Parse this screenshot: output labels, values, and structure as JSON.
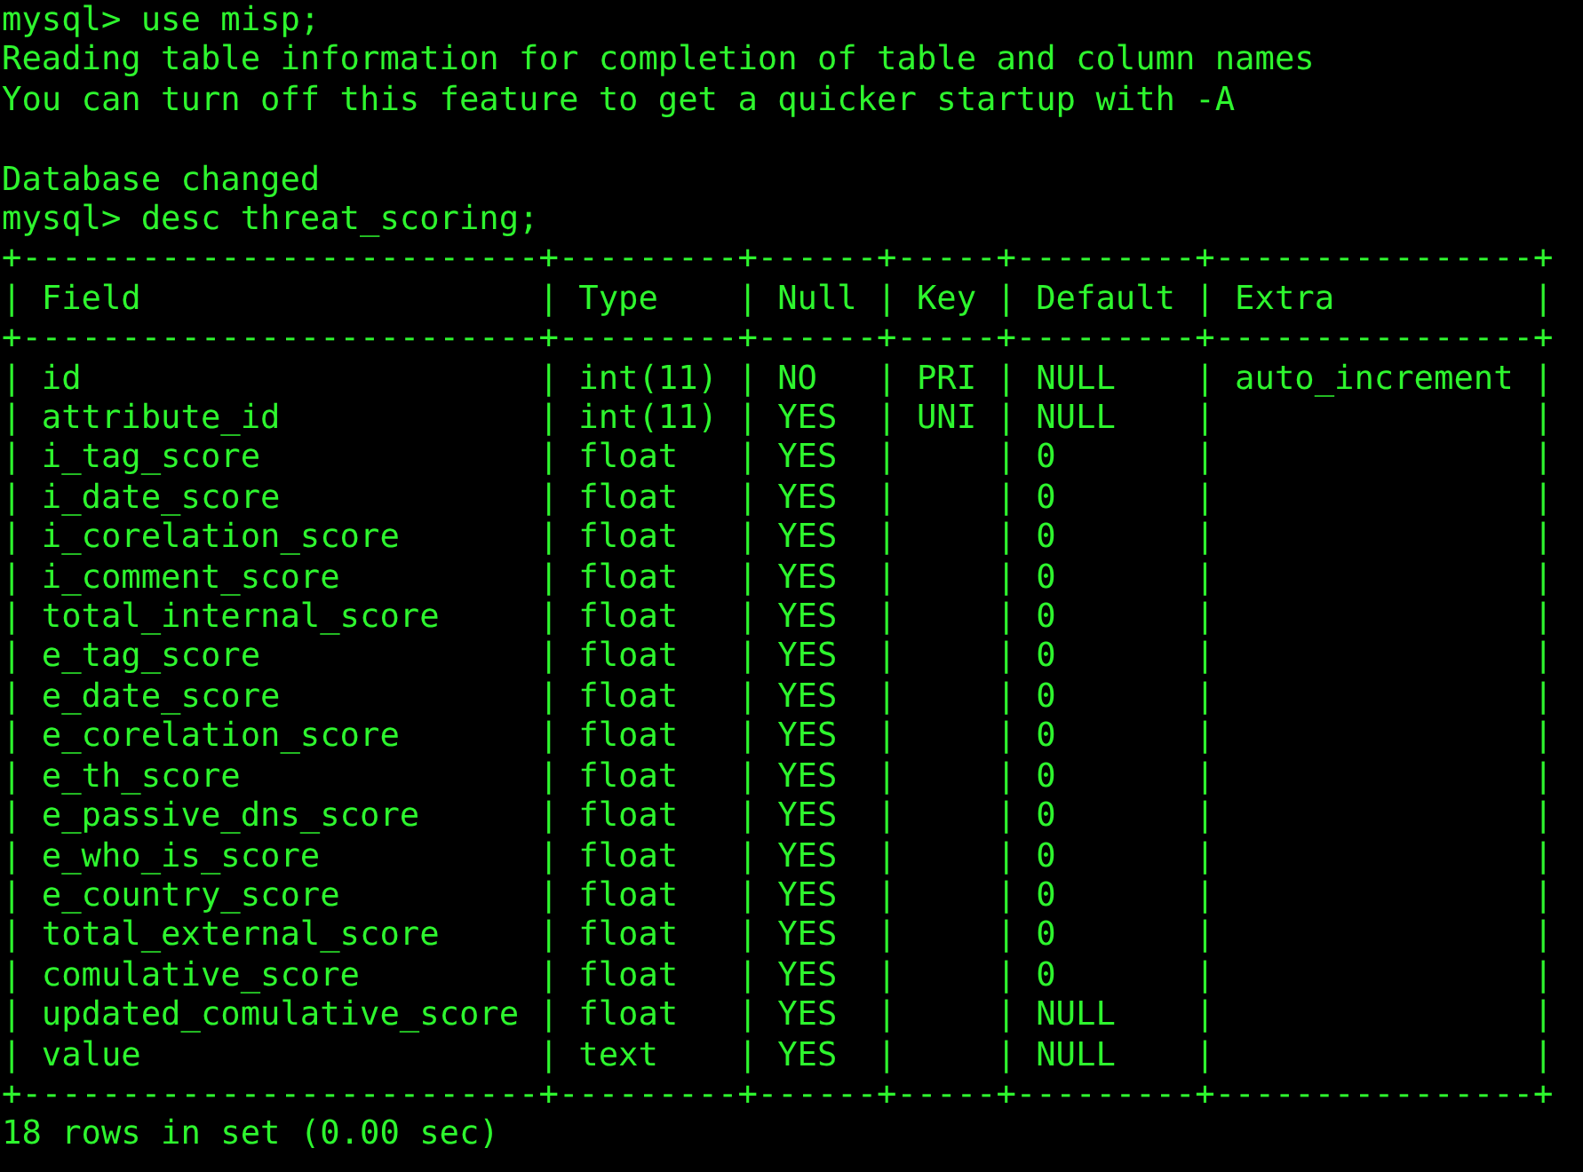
{
  "terminal": {
    "groups": [
      [
        "mysql> use misp;",
        "Reading table information for completion of table and column names",
        "You can turn off this feature to get a quicker startup with -A"
      ],
      [
        "Database changed",
        "mysql> desc threat_scoring;",
        "+--------------------------+---------+------+-----+---------+----------------+",
        "| Field                    | Type    | Null | Key | Default | Extra          |",
        "+--------------------------+---------+------+-----+---------+----------------+",
        "| id                       | int(11) | NO   | PRI | NULL    | auto_increment |",
        "| attribute_id             | int(11) | YES  | UNI | NULL    |                |",
        "| i_tag_score              | float   | YES  |     | 0       |                |",
        "| i_date_score             | float   | YES  |     | 0       |                |",
        "| i_corelation_score       | float   | YES  |     | 0       |                |",
        "| i_comment_score          | float   | YES  |     | 0       |                |",
        "| total_internal_score     | float   | YES  |     | 0       |                |",
        "| e_tag_score              | float   | YES  |     | 0       |                |",
        "| e_date_score             | float   | YES  |     | 0       |                |",
        "| e_corelation_score       | float   | YES  |     | 0       |                |",
        "| e_th_score               | float   | YES  |     | 0       |                |",
        "| e_passive_dns_score      | float   | YES  |     | 0       |                |",
        "| e_who_is_score           | float   | YES  |     | 0       |                |",
        "| e_country_score          | float   | YES  |     | 0       |                |",
        "| total_external_score     | float   | YES  |     | 0       |                |",
        "| comulative_score         | float   | YES  |     | 0       |                |",
        "| updated_comulative_score | float   | YES  |     | NULL    |                |",
        "| value                    | text    | YES  |     | NULL    |                |",
        "+--------------------------+---------+------+-----+---------+----------------+",
        "18 rows in set (0.00 sec)"
      ]
    ]
  }
}
